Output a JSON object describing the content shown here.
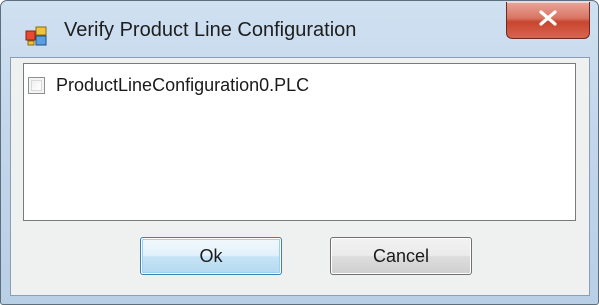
{
  "window": {
    "title": "Verify Product Line Configuration",
    "app_icon": "app-window-icon",
    "close_icon": "close-x-icon"
  },
  "list": {
    "items": [
      {
        "label": "ProductLineConfiguration0.PLC",
        "checked": false
      }
    ]
  },
  "buttons": {
    "ok_label": "Ok",
    "cancel_label": "Cancel"
  },
  "colors": {
    "close_button": "#d14e37",
    "default_button_border": "#3c7fb1",
    "frame": "#c3d6ea"
  }
}
